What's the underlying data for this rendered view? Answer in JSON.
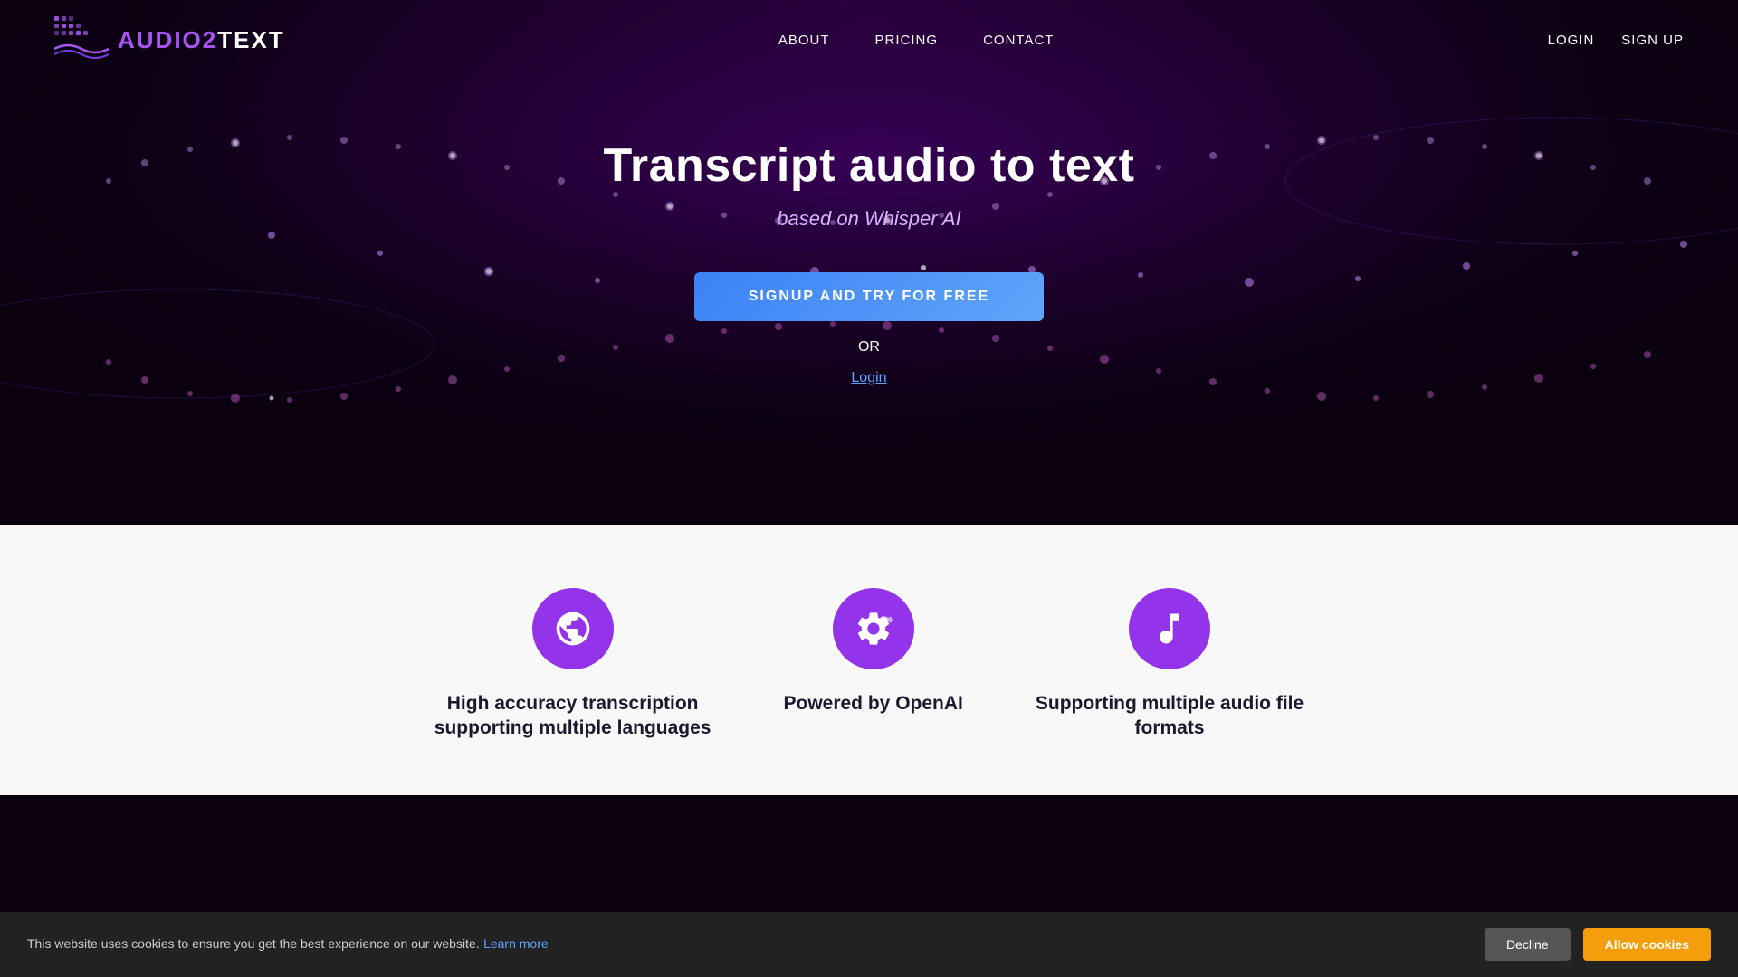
{
  "brand": {
    "name_part1": "AUDIO2",
    "name_part2": "TEXT",
    "logo_alt": "Audio2Text logo"
  },
  "nav": {
    "links": [
      {
        "label": "ABOUT",
        "id": "about"
      },
      {
        "label": "PRICING",
        "id": "pricing"
      },
      {
        "label": "CONTACT",
        "id": "contact"
      }
    ],
    "auth": {
      "login": "LOGIN",
      "signup": "SIGN UP"
    }
  },
  "hero": {
    "title": "Transcript audio to text",
    "subtitle": "based on Whisper AI",
    "cta_label": "SIGNUP AND TRY FOR FREE",
    "or_text": "OR",
    "login_label": "Login"
  },
  "features": [
    {
      "icon": "globe",
      "title": "High accuracy transcription",
      "title_line2": "supporting multiple languages"
    },
    {
      "icon": "gears",
      "title": "Powered by OpenAI"
    },
    {
      "icon": "music",
      "title": "Supporting multiple audio file",
      "title_line2": "formats"
    }
  ],
  "cookie": {
    "message": "This website uses cookies to ensure you get the best experience on our website.",
    "learn_more": "Learn more",
    "decline_label": "Decline",
    "allow_label": "Allow cookies"
  }
}
